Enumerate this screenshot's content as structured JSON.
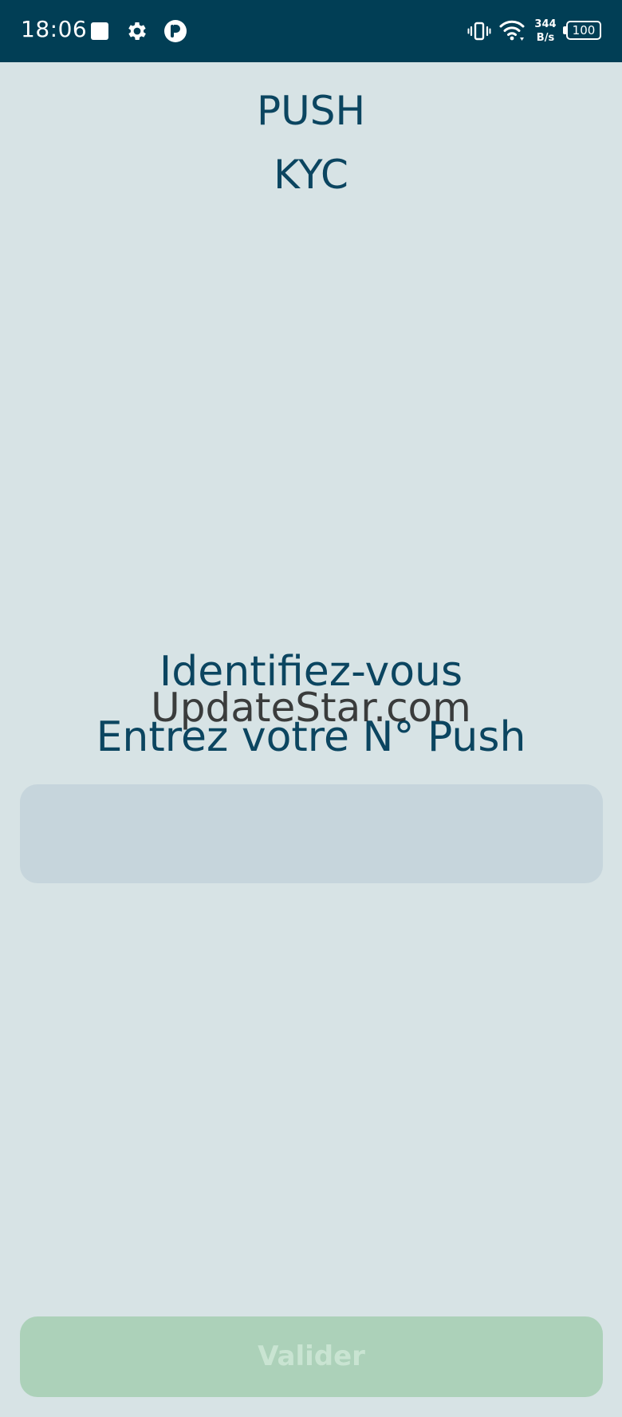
{
  "status_bar": {
    "time": "18:06",
    "icons": [
      "square-notification-icon",
      "gear-icon",
      "p-app-icon",
      "vibrate-icon",
      "wifi-icon",
      "battery-icon"
    ],
    "network_speed_value": "344",
    "network_speed_unit": "B/s",
    "battery_level": "100",
    "background_color": "#013e55"
  },
  "header": {
    "title_line1": "PUSH",
    "title_line2": "KYC"
  },
  "login": {
    "heading": "Identifiez-vous",
    "instruction": "Entrez votre N° Push",
    "push_number_input": {
      "value": "",
      "placeholder": ""
    },
    "submit_label": "Valider"
  },
  "watermark": "UpdateStar.com",
  "colors": {
    "background": "#d7e3e5",
    "text_primary": "#0b4560",
    "input_background": "#c6d5dc",
    "button_background": "#acd1b9",
    "button_text": "#c9e4d2"
  }
}
